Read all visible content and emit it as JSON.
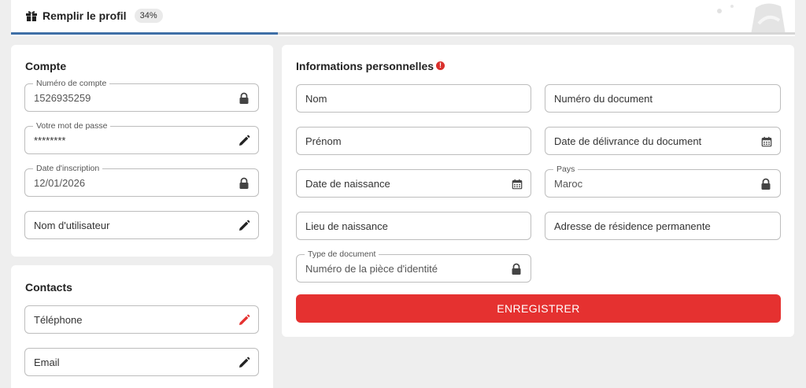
{
  "header": {
    "title": "Remplir le profil",
    "progress_label": "34%",
    "progress": 0.34
  },
  "account": {
    "title": "Compte",
    "account_number": {
      "label": "Numéro de compte",
      "value": "1526935259",
      "icon": "lock-icon"
    },
    "password": {
      "label": "Votre mot de passe",
      "value": "********",
      "icon": "pencil-icon"
    },
    "registration_date": {
      "label": "Date d'inscription",
      "value": "12/01/2026",
      "icon": "lock-icon"
    },
    "username": {
      "placeholder": "Nom d'utilisateur",
      "icon": "pencil-icon"
    }
  },
  "contacts": {
    "title": "Contacts",
    "phone": {
      "placeholder": "Téléphone",
      "icon": "pencil-icon",
      "icon_color": "#e53130"
    },
    "email": {
      "placeholder": "Email",
      "icon": "pencil-icon"
    }
  },
  "personal": {
    "title": "Informations personnelles",
    "alert_icon": "exclamation-icon",
    "last_name": {
      "placeholder": "Nom"
    },
    "document_number": {
      "placeholder": "Numéro du document"
    },
    "first_name": {
      "placeholder": "Prénom"
    },
    "document_issue_date": {
      "placeholder": "Date de délivrance du document",
      "icon": "calendar-icon"
    },
    "birth_date": {
      "placeholder": "Date de naissance",
      "icon": "calendar-icon"
    },
    "country": {
      "label": "Pays",
      "value": "Maroc",
      "icon": "lock-icon"
    },
    "birth_place": {
      "placeholder": "Lieu de naissance"
    },
    "permanent_address": {
      "placeholder": "Adresse de résidence permanente"
    },
    "document_type": {
      "label": "Type de document",
      "value": "Numéro de la pièce d'identité",
      "icon": "lock-icon"
    },
    "save_label": "ENREGISTRER"
  },
  "colors": {
    "accent": "#e53130",
    "progress": "#3f6fa6",
    "background": "#eeeeee"
  }
}
